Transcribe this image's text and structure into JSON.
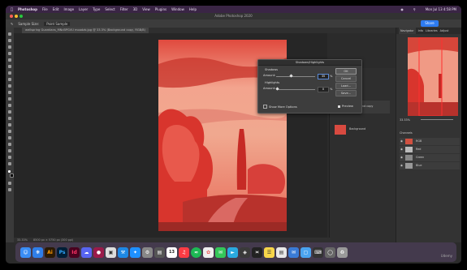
{
  "menubar": {
    "items": [
      "Photoshop",
      "File",
      "Edit",
      "Image",
      "Layer",
      "Type",
      "Select",
      "Filter",
      "3D",
      "View",
      "Plugins",
      "Window",
      "Help"
    ],
    "clock": "Mon Jul 13 4:58 PM"
  },
  "window": {
    "title": "Adobe Photoshop 2020"
  },
  "options": {
    "sample_label": "Sample Size:",
    "sample_value": "Point Sample",
    "share_label": "Share"
  },
  "document": {
    "tab": "wellspring Guardians_MNcBPGVU moodzb.jpg @ 33.3% (Background copy, RGB/8)"
  },
  "status": {
    "zoom": "33.33%",
    "doc": "8500 px × 5750 px (300 ppi)"
  },
  "dialog": {
    "title": "Shadows/Highlights",
    "shadows_label": "Shadows",
    "amount_label": "Amount:",
    "shadows_amount": "35",
    "highlights_label": "Highlights",
    "highlights_amount": "0",
    "percent": "%",
    "show_more": "Show More Options",
    "preview": "Preview",
    "ok": "OK",
    "cancel": "Cancel",
    "load": "Load...",
    "save": "Save..."
  },
  "navigator": {
    "tabs": [
      "Navigator",
      "Info",
      "Libraries",
      "Adjust"
    ],
    "zoom": "33.33%"
  },
  "layers": {
    "items": [
      "Background copy",
      "Background"
    ]
  },
  "channels": {
    "title": "Channels",
    "items": [
      "RGB",
      "Red",
      "Green",
      "Blue"
    ]
  },
  "dock": {
    "apps": [
      "Finder",
      "Safari",
      "Ai",
      "Ps",
      "Id",
      "Discord",
      "App",
      "Xcode",
      "App Store",
      "System Preferences",
      "Calendar",
      "Music",
      "Spotify",
      "Photos",
      "Messages",
      "Notes",
      "Preview",
      "Mail",
      "Folder",
      "Trash"
    ],
    "calendar_day": "13"
  },
  "watermark": "Udemy"
}
